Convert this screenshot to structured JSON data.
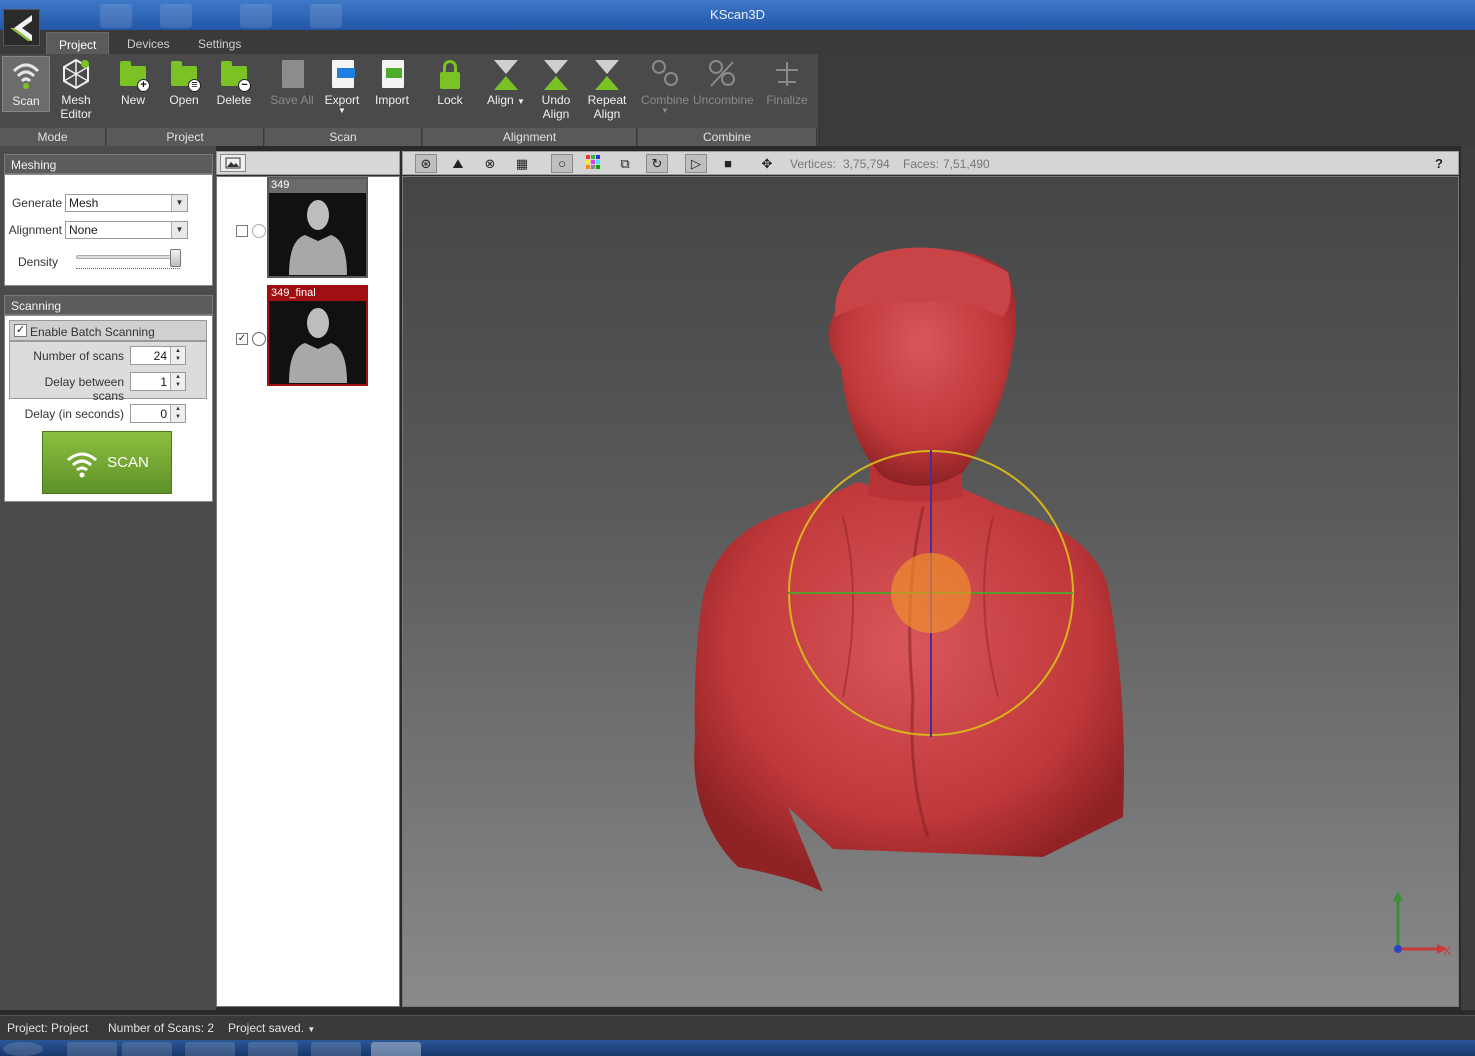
{
  "window": {
    "title": "KScan3D"
  },
  "ribbon": {
    "tabs": [
      {
        "label": "Project",
        "active": true
      },
      {
        "label": "Devices",
        "active": false
      },
      {
        "label": "Settings",
        "active": false
      }
    ],
    "groups": {
      "mode": "Mode",
      "project": "Project",
      "scan": "Scan",
      "alignment": "Alignment",
      "combine": "Combine"
    },
    "buttons": {
      "scan": "Scan",
      "mesh_editor": "Mesh\nEditor",
      "new": "New",
      "open": "Open",
      "delete": "Delete",
      "save_all": "Save All",
      "export": "Export",
      "import": "Import",
      "lock": "Lock",
      "align": "Align",
      "undo_align": "Undo\nAlign",
      "repeat_align": "Repeat\nAlign",
      "combine": "Combine",
      "uncombine": "Uncombine",
      "finalize": "Finalize"
    }
  },
  "meshing": {
    "header": "Meshing",
    "generate_label": "Generate",
    "generate_value": "Mesh",
    "alignment_label": "Alignment",
    "alignment_value": "None",
    "density_label": "Density",
    "density_level": 1.0
  },
  "scanning": {
    "header": "Scanning",
    "batch_label": "Enable Batch Scanning",
    "batch_enabled": true,
    "num_scans_label": "Number of scans",
    "num_scans_value": "24",
    "delay_between_label": "Delay between scans",
    "delay_between_value": "1",
    "delay_label": "Delay (in seconds)",
    "delay_value": "0",
    "scan_button": "SCAN"
  },
  "scan_list": [
    {
      "name": "349",
      "checked": false,
      "selected": false
    },
    {
      "name": "349_final",
      "checked": true,
      "selected": true
    }
  ],
  "view": {
    "vertices_label": "Vertices:",
    "vertices_value": "3,75,794",
    "faces_label": "Faces:",
    "faces_value": "7,51,490",
    "help": "?",
    "axis_x": "X",
    "mesh_color": "#c0383a"
  },
  "status": {
    "project": "Project:  Project",
    "num_scans": "Number of Scans:  2",
    "saved": "Project saved."
  }
}
